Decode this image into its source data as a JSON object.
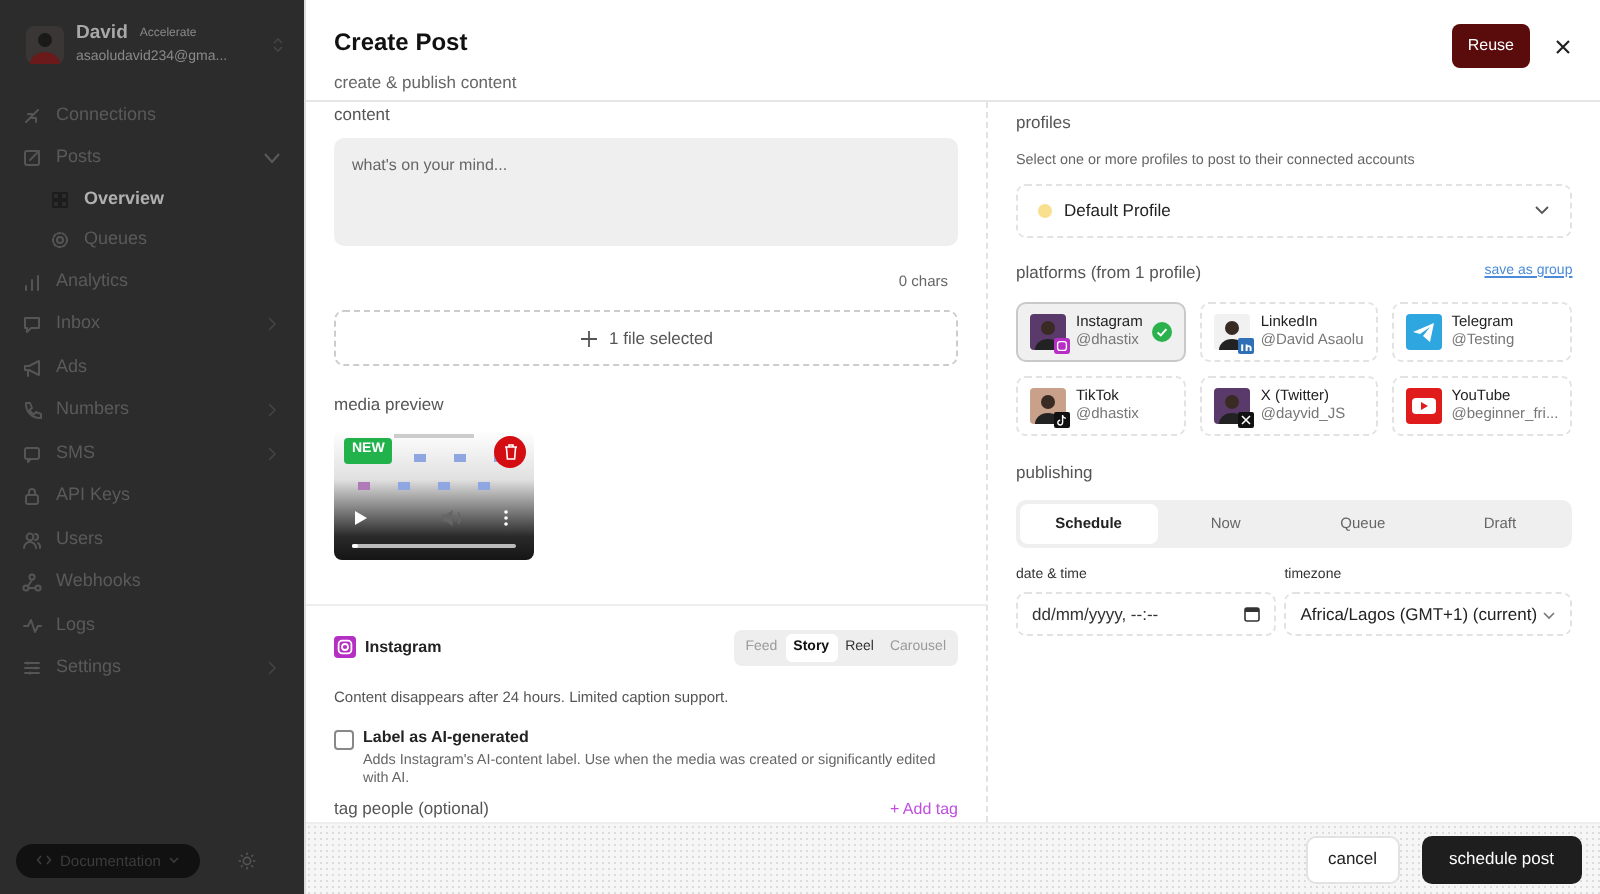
{
  "sidebar": {
    "user": {
      "name": "David",
      "plan": "Accelerate",
      "email": "asaoludavid234@gma..."
    },
    "items": [
      {
        "label": "Connections",
        "selected": false
      },
      {
        "label": "Posts",
        "selected": false,
        "expanded": true,
        "children": [
          {
            "label": "Overview",
            "selected": true
          },
          {
            "label": "Queues",
            "selected": false
          }
        ]
      },
      {
        "label": "Analytics",
        "selected": false
      },
      {
        "label": "Inbox",
        "selected": false,
        "expanded": false
      },
      {
        "label": "Ads",
        "selected": false
      },
      {
        "label": "Numbers",
        "selected": false,
        "expanded": false
      },
      {
        "label": "SMS",
        "selected": false,
        "expanded": false
      },
      {
        "label": "API Keys",
        "selected": false
      },
      {
        "label": "Users",
        "selected": false
      },
      {
        "label": "Webhooks",
        "selected": false
      },
      {
        "label": "Logs",
        "selected": false
      },
      {
        "label": "Settings",
        "selected": false,
        "expanded": false
      }
    ],
    "documentation": "Documentation"
  },
  "dialog": {
    "title": "Create Post",
    "subtitle": "create & publish content",
    "reuse": "Reuse"
  },
  "content": {
    "label": "content",
    "placeholder": "what's on your mind...",
    "count": "0 chars",
    "upload": "1 file selected",
    "media_label": "media preview",
    "media_badge": "NEW",
    "video_progress": {
      "level": 0.04
    }
  },
  "instagram": {
    "name": "Instagram",
    "types": [
      {
        "label": "Feed",
        "selected": false,
        "disabled": true
      },
      {
        "label": "Story",
        "selected": true,
        "disabled": false
      },
      {
        "label": "Reel",
        "selected": false,
        "disabled": false
      },
      {
        "label": "Carousel",
        "selected": false,
        "disabled": true
      }
    ],
    "note": "Content disappears after 24 hours. Limited caption support.",
    "ai_label": {
      "label": "Label as AI-generated",
      "checked": false,
      "description": "Adds Instagram's AI-content label. Use when the media was created or significantly edited with AI."
    },
    "tag_label": "tag people (optional)",
    "add_tag": "+ Add tag"
  },
  "profiles": {
    "label": "profiles",
    "hint": "Select one or more profiles to post to their connected accounts",
    "selected_profile": {
      "name": "Default Profile",
      "color": "#f8e08e"
    }
  },
  "platforms": {
    "label": "platforms (from 1 profile)",
    "save_link": "save as group",
    "items": [
      {
        "name": "Instagram",
        "handle": "@dhastix",
        "selected": true,
        "kind": "avatar"
      },
      {
        "name": "LinkedIn",
        "handle": "@David Asaolu",
        "selected": false,
        "kind": "avatar"
      },
      {
        "name": "Telegram",
        "handle": "@Testing",
        "selected": false,
        "kind": "logo"
      },
      {
        "name": "TikTok",
        "handle": "@dhastix",
        "selected": false,
        "kind": "avatar"
      },
      {
        "name": "X (Twitter)",
        "handle": "@dayvid_JS",
        "selected": false,
        "kind": "avatar"
      },
      {
        "name": "YouTube",
        "handle": "@beginner_fri...",
        "selected": false,
        "kind": "logo"
      }
    ]
  },
  "publishing": {
    "label": "publishing",
    "tabs": [
      {
        "label": "Schedule",
        "selected": true
      },
      {
        "label": "Now",
        "selected": false
      },
      {
        "label": "Queue",
        "selected": false
      },
      {
        "label": "Draft",
        "selected": false
      }
    ],
    "date_label": "date & time",
    "date_placeholder": "dd/mm/yyyy, --:--",
    "timezone_label": "timezone",
    "timezone": "Africa/Lagos (GMT+1) (current)"
  },
  "footer": {
    "cancel": "cancel",
    "submit": "schedule post"
  }
}
